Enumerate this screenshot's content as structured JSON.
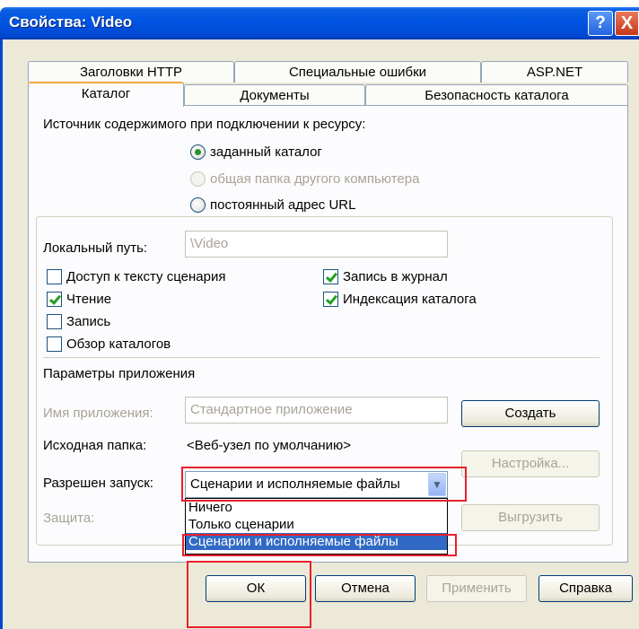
{
  "window": {
    "title": "Свойства: Video",
    "help_glyph": "?",
    "close_glyph": "X"
  },
  "tabs": {
    "row_back": [
      "Заголовки HTTP",
      "Специальные ошибки",
      "ASP.NET"
    ],
    "row_front": [
      "Каталог",
      "Документы",
      "Безопасность каталога"
    ],
    "active": "Каталог"
  },
  "content_source": {
    "label": "Источник содержимого при подключении к ресурсу:",
    "options": [
      {
        "label": "заданный каталог",
        "checked": true,
        "disabled": false
      },
      {
        "label": "общая папка другого компьютера",
        "checked": false,
        "disabled": true
      },
      {
        "label": "постоянный адрес URL",
        "checked": false,
        "disabled": false
      }
    ]
  },
  "local_path": {
    "label": "Локальный путь:",
    "value": "\\Video"
  },
  "permissions": {
    "script_access": {
      "label": "Доступ к тексту сценария",
      "checked": false
    },
    "read": {
      "label": "Чтение",
      "checked": true
    },
    "write": {
      "label": "Запись",
      "checked": false
    },
    "browse": {
      "label": "Обзор каталогов",
      "checked": false
    },
    "log": {
      "label": "Запись в журнал",
      "checked": true
    },
    "index": {
      "label": "Индексация каталога",
      "checked": true
    }
  },
  "app_settings": {
    "header": "Параметры приложения",
    "app_name_label": "Имя приложения:",
    "app_name_value": "Стандартное приложение",
    "create_button": "Создать",
    "start_folder_label": "Исходная папка:",
    "start_folder_value": "<Веб-узел по умолчанию>",
    "config_button": "Настройка...",
    "exec_label": "Разрешен запуск:",
    "exec_value": "Сценарии и исполняемые файлы",
    "exec_options": [
      "Ничего",
      "Только сценарии",
      "Сценарии и исполняемые файлы"
    ],
    "exec_selected_index": 2,
    "protection_label": "Защита:",
    "unload_button": "Выгрузить"
  },
  "footer_buttons": {
    "ok": "ОК",
    "cancel": "Отмена",
    "apply": "Применить",
    "help": "Справка"
  },
  "colors": {
    "title_bar": "#0054e3",
    "dialog_bg": "#ece9d8",
    "highlight": "#e8202a",
    "selection": "#316ac5"
  }
}
